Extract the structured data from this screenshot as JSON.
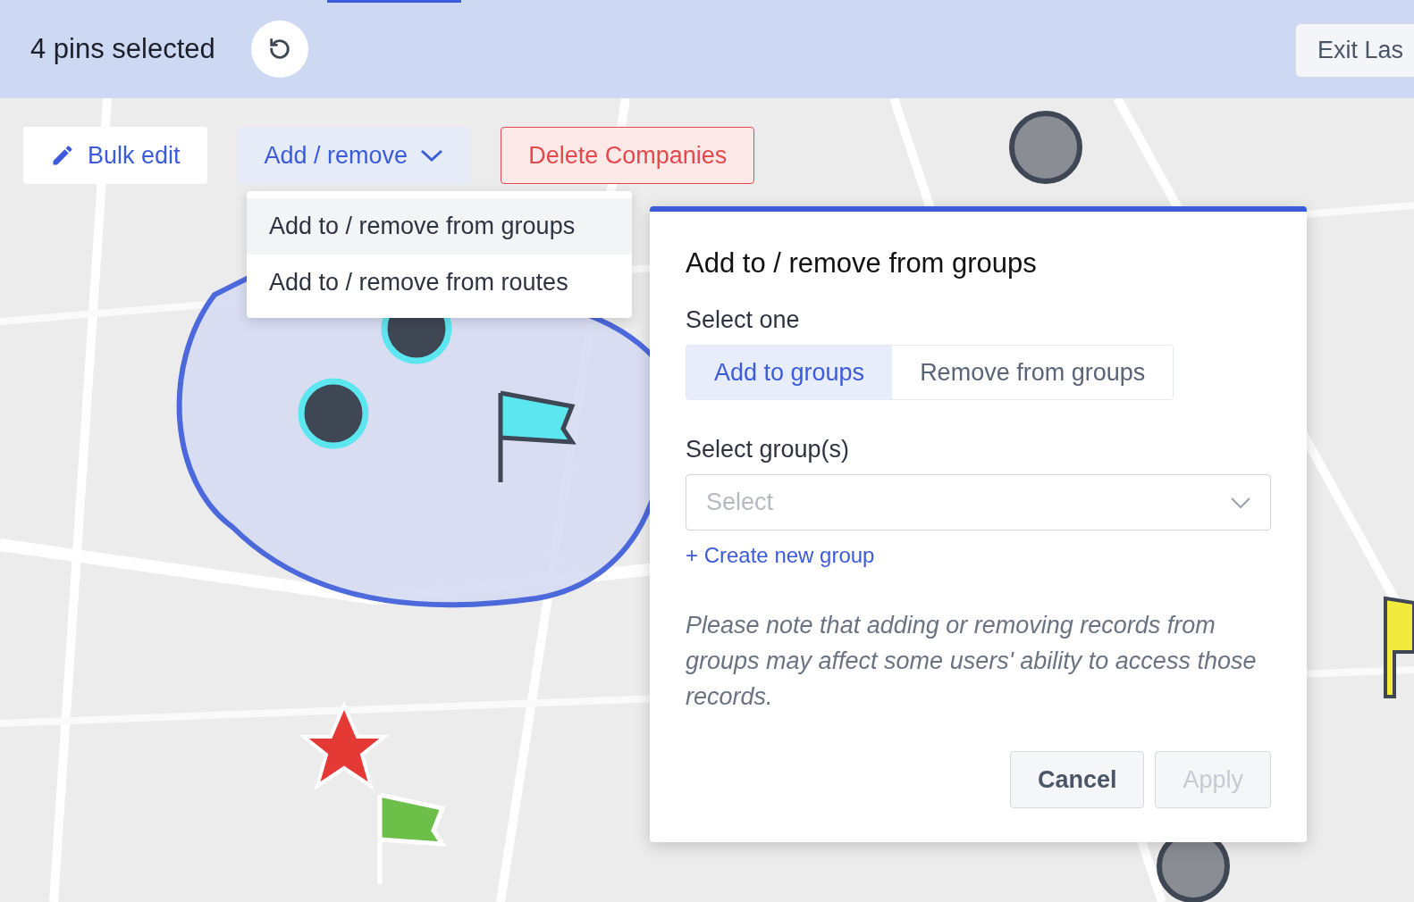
{
  "header": {
    "selection_count": "4 pins selected",
    "exit_button": "Exit Las"
  },
  "toolbar": {
    "bulk_edit": "Bulk edit",
    "add_remove": {
      "label": "Add / remove",
      "expanded": true
    },
    "delete_button": "Delete Companies"
  },
  "menu": {
    "items": [
      {
        "label": "Add to / remove from groups",
        "selected": true
      },
      {
        "label": "Add to / remove from routes",
        "selected": false
      }
    ]
  },
  "dialog": {
    "title": "Add to / remove from groups",
    "mode_label": "Select one",
    "modes": [
      {
        "label": "Add to groups",
        "selected": true
      },
      {
        "label": "Remove from groups",
        "selected": false
      }
    ],
    "group_label": "Select group(s)",
    "group_select": {
      "placeholder": "Select"
    },
    "create_link": "+ Create new group",
    "note": "Please note that adding or removing records from groups may affect some users' ability to access those records.",
    "buttons": [
      {
        "label": "Cancel",
        "disabled": false
      },
      {
        "label": "Apply",
        "disabled": true
      }
    ]
  }
}
